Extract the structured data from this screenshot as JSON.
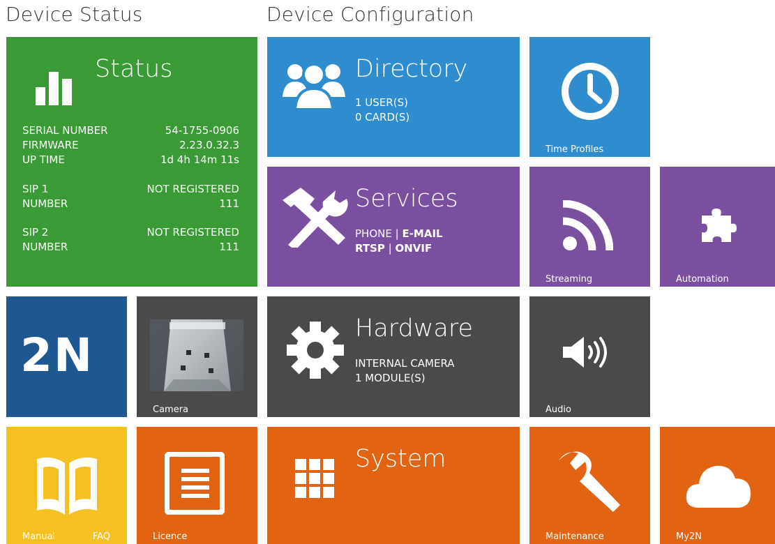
{
  "headings": {
    "device_status": "Device Status",
    "device_configuration": "Device Configuration"
  },
  "status": {
    "title": "Status",
    "rows_top": [
      {
        "label": "SERIAL NUMBER",
        "value": "54-1755-0906"
      },
      {
        "label": "FIRMWARE",
        "value": "2.23.0.32.3"
      },
      {
        "label": "UP TIME",
        "value": "1d 4h 14m 11s"
      }
    ],
    "sip1": {
      "label": "SIP 1",
      "value": "NOT REGISTERED",
      "number_label": "NUMBER",
      "number": "111"
    },
    "sip2": {
      "label": "SIP 2",
      "value": "NOT REGISTERED",
      "number_label": "NUMBER",
      "number": "111"
    }
  },
  "directory": {
    "title": "Directory",
    "line1": "1 USER(S)",
    "line2": "0 CARD(S)"
  },
  "time_profiles": {
    "label": "Time Profiles"
  },
  "services": {
    "title": "Services",
    "phone": "PHONE",
    "sep": " | ",
    "email": "E-MAIL",
    "rtsp": "RTSP",
    "onvif": "ONVIF"
  },
  "streaming": {
    "label": "Streaming"
  },
  "automation": {
    "label": "Automation"
  },
  "logo": {
    "text": "2N"
  },
  "camera": {
    "label": "Camera"
  },
  "hardware": {
    "title": "Hardware",
    "line1": "INTERNAL CAMERA",
    "line2": "1 MODULE(S)"
  },
  "audio": {
    "label": "Audio"
  },
  "manual": {
    "label": "Manual",
    "faq": "FAQ"
  },
  "licence": {
    "label": "Licence"
  },
  "system": {
    "title": "System"
  },
  "maintenance": {
    "label": "Maintenance"
  },
  "my2n": {
    "label": "My2N"
  },
  "colors": {
    "green": "#3a9a35",
    "blue": "#2f8ccf",
    "purple": "#7b4fa0",
    "dark": "#4a4a4a",
    "navy": "#1f5793",
    "yellow": "#f6c022",
    "orange": "#e26312"
  },
  "icons": {
    "status": "bar-chart-icon",
    "directory": "users-icon",
    "time_profiles": "clock-icon",
    "services": "tools-icon",
    "streaming": "rss-icon",
    "automation": "puzzle-icon",
    "hardware": "gear-icon",
    "audio": "speaker-icon",
    "manual": "book-icon",
    "licence": "document-icon",
    "system": "grid-icon",
    "maintenance": "wrench-icon",
    "my2n": "cloud-icon"
  }
}
